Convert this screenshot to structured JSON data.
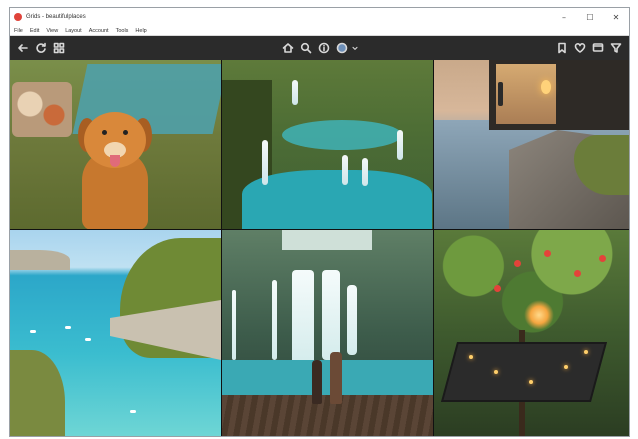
{
  "window": {
    "title": "Grids - beautifulplaces",
    "controls": {
      "minimize": "–",
      "maximize": "☐",
      "close": "✕"
    }
  },
  "menu": {
    "items": [
      "File",
      "Edit",
      "View",
      "Layout",
      "Account",
      "Tools",
      "Help"
    ]
  },
  "toolbar": {
    "left_icons": [
      "back-arrow-icon",
      "refresh-icon",
      "grid-icon"
    ],
    "center_icons": [
      "home-icon",
      "search-icon",
      "info-icon",
      "avatar-icon",
      "chevron-down-icon"
    ],
    "right_icons": [
      "bookmark-icon",
      "heart-icon",
      "message-icon",
      "filter-icon"
    ]
  },
  "grid": {
    "tiles": [
      "dog-picnic",
      "waterfall-canyon",
      "sunset-cliff-house",
      "turquoise-cove",
      "waterfall-couple",
      "treehouse-dinner"
    ]
  }
}
